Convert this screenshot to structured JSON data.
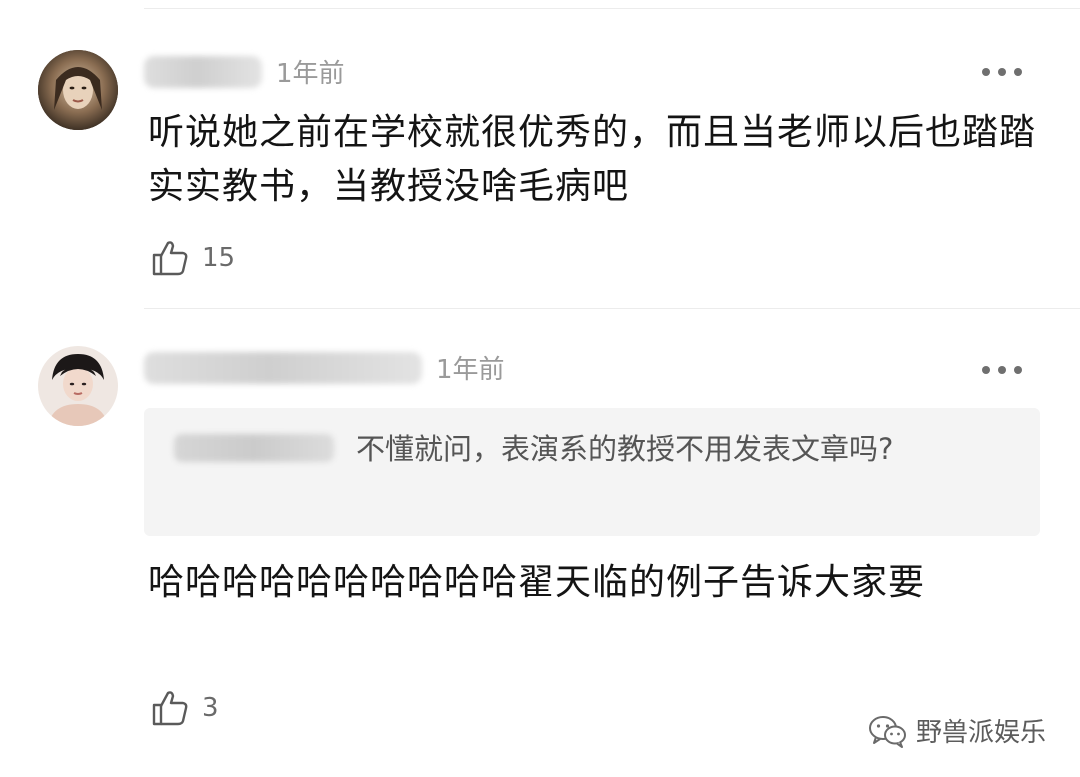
{
  "comments": [
    {
      "time": "1年前",
      "text": "听说她之前在学校就很优秀的，而且当老师以后也踏踏实实教书，当教授没啥毛病吧",
      "likes": "15"
    },
    {
      "time": "1年前",
      "quote": "不懂就问，表演系的教授不用发表文章吗?",
      "text": "哈哈哈哈哈哈哈哈哈哈翟天临的例子告诉大家要",
      "likes": "3"
    }
  ],
  "watermark": {
    "text": "野兽派娱乐",
    "icon": "wechat-icon"
  },
  "icons": {
    "like": "thumbs-up-icon",
    "more": "more-icon"
  }
}
